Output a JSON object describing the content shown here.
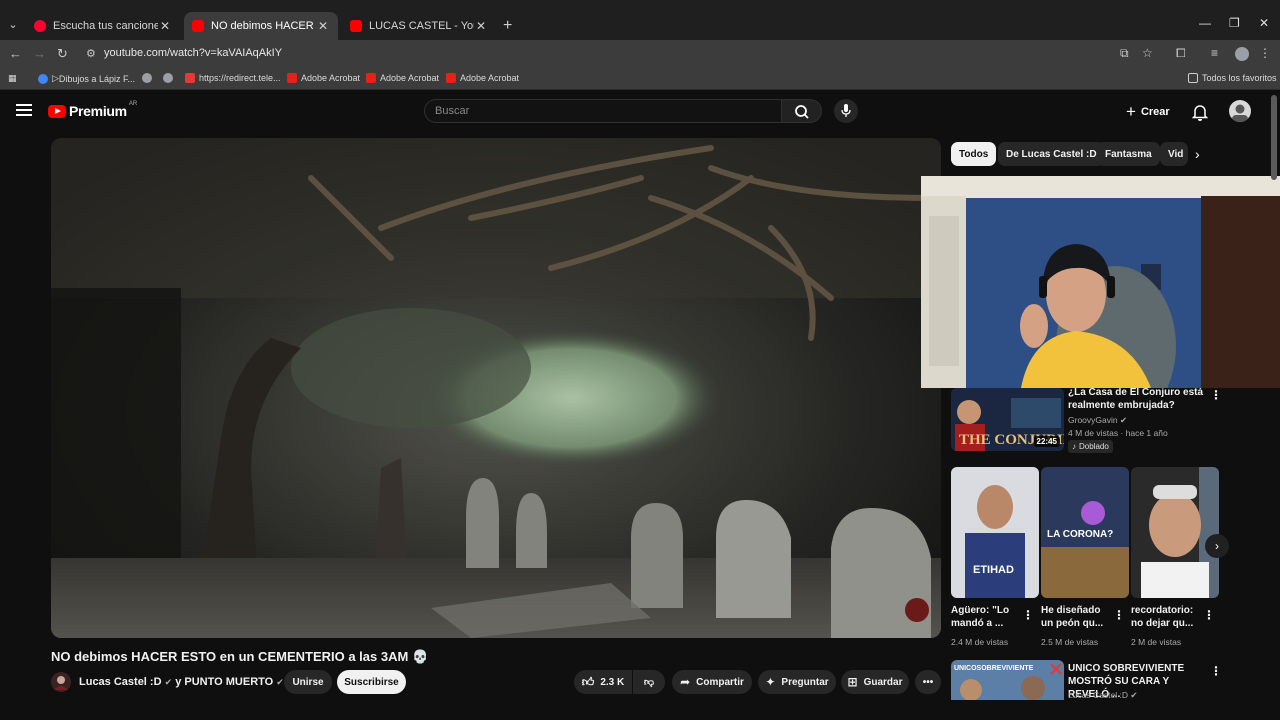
{
  "browser": {
    "tabs": [
      {
        "title": "Escucha tus canciones y álbum",
        "active": false
      },
      {
        "title": "NO debimos HACER ESTO en u",
        "active": true
      },
      {
        "title": "LUCAS CASTEL - YouTube",
        "active": false
      }
    ],
    "url": "youtube.com/watch?v=kaVAIAqAkIY",
    "bookmarks": [
      "Dibujos a Lápiz F...",
      "https://redirect.tele...",
      "Adobe Acrobat",
      "Adobe Acrobat",
      "Adobe Acrobat"
    ],
    "bookmarks_folder": "Todos los favoritos"
  },
  "youtube": {
    "logo_text": "Premium",
    "logo_region": "AR",
    "search_placeholder": "Buscar",
    "create_label": "Crear"
  },
  "video": {
    "title": "NO debimos HACER ESTO en un CEMENTERIO a las 3AM",
    "title_emoji": "💀",
    "channel": "Lucas Castel :D",
    "channel_joiner": "y",
    "collab_channel": "PUNTO MUERTO",
    "join_label": "Unirse",
    "subscribe_label": "Suscribirse",
    "likes": "2.3 K",
    "share_label": "Compartir",
    "ask_label": "Preguntar",
    "save_label": "Guardar"
  },
  "chips": [
    "Todos",
    "De Lucas Castel :D",
    "Fantasma",
    "Vid"
  ],
  "recommendations": [
    {
      "title": "¿La Casa de El Conjuro está realmente embrujada?",
      "channel": "GroovyGavin",
      "meta": "4 M de vistas · hace 1 año",
      "badge": "Doblado",
      "duration": "22:45",
      "thumb_text": "THE CONJURIN"
    },
    {
      "title": "UNICO SOBREVIVIENTE MOSTRÓ SU CARA Y REVELÓ ...",
      "channel": "Lucas Castel :D",
      "thumb_text": "UNICOSOBREVIVIENTE"
    }
  ],
  "shorts": [
    {
      "title": "Agüero: \"Lo mandó a ...",
      "views": "2.4 M de vistas",
      "thumb_text": "ETIHAD"
    },
    {
      "title": "He diseñado un peón qu...",
      "views": "2.5 M de vistas",
      "thumb_text": "LA CORONA?"
    },
    {
      "title": "recordatorio: no dejar qu...",
      "views": "2 M de vistas",
      "thumb_text": ""
    }
  ]
}
